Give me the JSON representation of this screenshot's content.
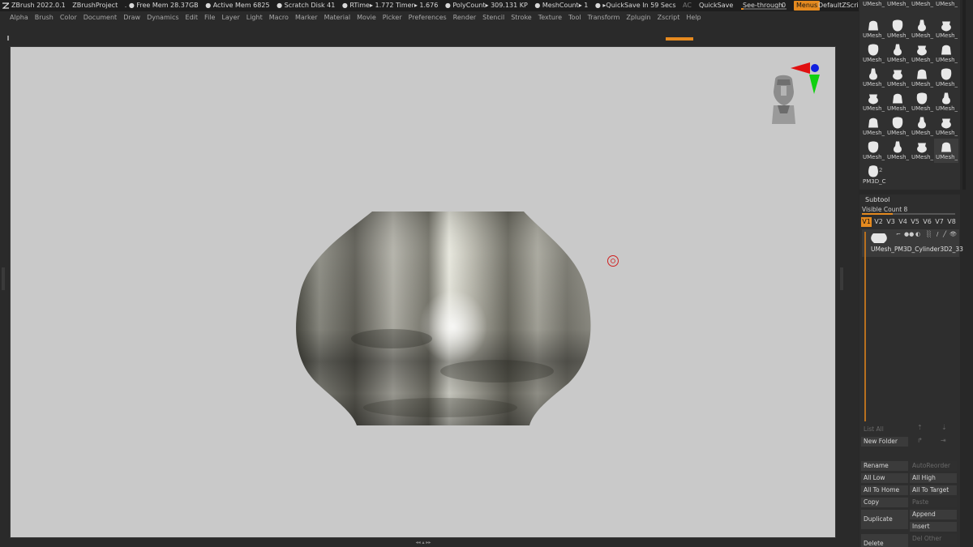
{
  "titlebar": {
    "app": "ZBrush 2022.0.1",
    "project": "ZBrushProject",
    "free_mem": ". ● Free Mem 28.37GB",
    "active_mem": "● Active Mem 6825",
    "scratch": "● Scratch Disk 41",
    "rtime": "●  RTime▸ 1.772 Timer▸ 1.676",
    "polycount": "● PolyCount▸ 309.131 KP",
    "meshcount": "●  MeshCount▸ 1",
    "quicksave_in": "●  ▸QuickSave In 59 Secs",
    "ac": "AC",
    "quicksave": "QuickSave",
    "see_through": "See-through",
    "see_through_value": "0",
    "menus": "Menus",
    "script": "DefaultZScript",
    "see_through_fill": 0.05
  },
  "menubar": [
    "Alpha",
    "Brush",
    "Color",
    "Document",
    "Draw",
    "Dynamics",
    "Edit",
    "File",
    "Layer",
    "Light",
    "Macro",
    "Marker",
    "Material",
    "Movie",
    "Picker",
    "Preferences",
    "Render",
    "Stencil",
    "Stroke",
    "Texture",
    "Tool",
    "Transform",
    "Zplugin",
    "Zscript",
    "Help"
  ],
  "tool_tiles": {
    "row0": [
      "UMesh_",
      "UMesh_",
      "UMesh_",
      "UMesh_"
    ],
    "row1": [
      "UMesh_",
      "UMesh_",
      "UMesh_",
      "UMesh_"
    ],
    "row2": [
      "UMesh_",
      "UMesh_",
      "UMesh_",
      "UMesh_"
    ],
    "row3": [
      "UMesh_",
      "UMesh_",
      "UMesh_",
      "UMesh_"
    ],
    "row4": [
      "UMesh_",
      "UMesh_",
      "UMesh_",
      "UMesh_"
    ],
    "row5": [
      "UMesh_",
      "UMesh_",
      "UMesh_",
      "UMesh_"
    ],
    "last": "PM3D_C",
    "last_badge": "2"
  },
  "subtool": {
    "title": "Subtool",
    "visible_count": "Visible Count 8",
    "visible_fill": 0.33,
    "tabs": [
      "V1",
      "V2",
      "V3",
      "V4",
      "V5",
      "V6",
      "V7",
      "V8"
    ],
    "active_tab": "V1",
    "item_name": "UMesh_PM3D_Cylinder3D2_33"
  },
  "buttons": {
    "list_all": "List All",
    "new_folder": "New Folder",
    "rename": "Rename",
    "auto_reorder": "AutoReorder",
    "all_low": "All Low",
    "all_high": "All High",
    "all_to_home": "All To Home",
    "all_to_target": "All To Target",
    "copy": "Copy",
    "paste": "Paste",
    "duplicate": "Duplicate",
    "append": "Append",
    "insert": "Insert",
    "delete": "Delete",
    "del_other": "Del Other"
  },
  "colors": {
    "accent": "#e58a1f",
    "viewport_bg": "#c9c9c9",
    "gizmo_red": "#e01010",
    "gizmo_green": "#10d010",
    "gizmo_blue": "#1020e0"
  }
}
